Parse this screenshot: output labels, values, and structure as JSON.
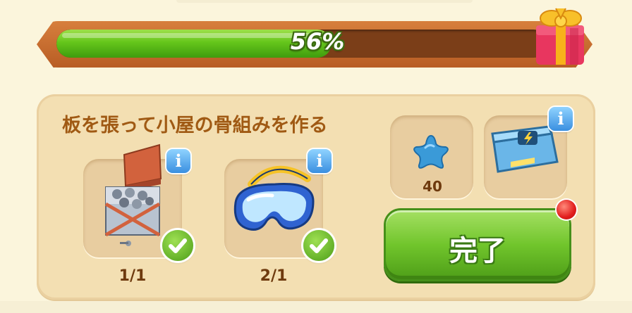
{
  "progress": {
    "value_percent": 56,
    "label": "56%"
  },
  "task": {
    "title": "板を張って小屋の骨組みを作る"
  },
  "requirements": [
    {
      "name": "crate of screws",
      "icon": "screw-crate-icon",
      "count": "1/1",
      "completed": true
    },
    {
      "name": "safety goggles",
      "icon": "goggles-icon",
      "count": "2/1",
      "completed": true
    }
  ],
  "rewards": [
    {
      "icon": "blue-star-icon",
      "count": "40"
    },
    {
      "icon": "energy-chest-icon"
    }
  ],
  "complete_button": {
    "label": "完了"
  },
  "colors": {
    "progress_fill": "#65c61b",
    "title_text": "#a05a14",
    "button_green": "#71c52c"
  }
}
